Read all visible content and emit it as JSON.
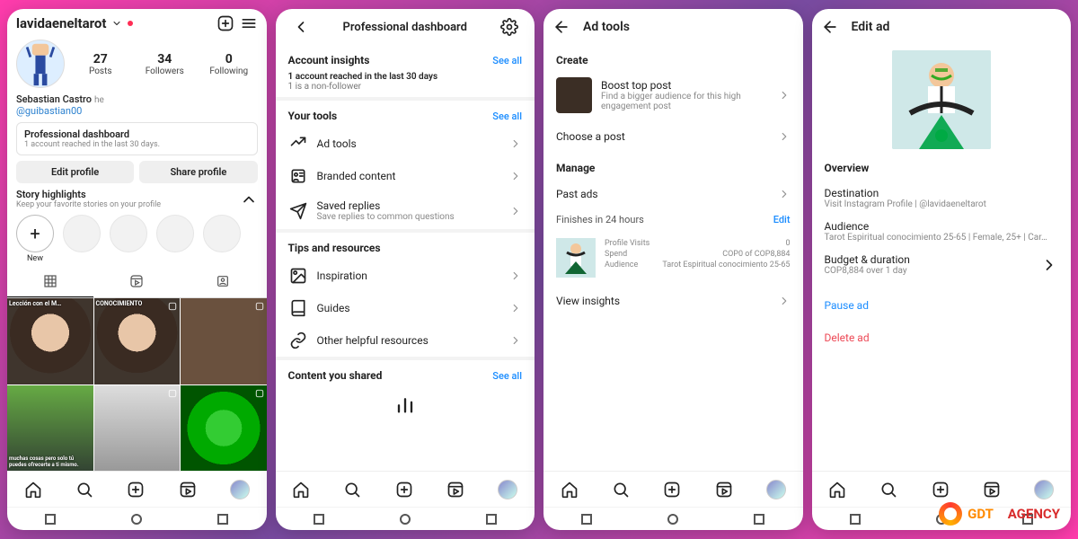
{
  "panel1": {
    "username": "lavidaeneltarot",
    "stats": {
      "posts": {
        "n": "27",
        "l": "Posts"
      },
      "followers": {
        "n": "34",
        "l": "Followers"
      },
      "following": {
        "n": "0",
        "l": "Following"
      }
    },
    "display_name": "Sebastian Castro",
    "pronoun": "he",
    "handle": "@guibastian00",
    "dash_card": {
      "title": "Professional dashboard",
      "sub": "1 account reached in the last 30 days."
    },
    "btn_edit": "Edit profile",
    "btn_share": "Share profile",
    "highlights": {
      "title": "Story highlights",
      "sub": "Keep your favorite stories on your profile",
      "new": "New"
    },
    "grid_caps": [
      "Lección con el M…",
      "CONOCIMIENTO",
      "",
      "muchas cosas pero solo tú puedes ofrecerte a ti mismo.",
      "",
      ""
    ]
  },
  "panel2": {
    "title": "Professional dashboard",
    "insights": {
      "h": "Account insights",
      "see": "See all",
      "l1": "1 account reached in the last 30 days",
      "l2": "1 is a non-follower"
    },
    "tools": {
      "h": "Your tools",
      "see": "See all",
      "items": [
        {
          "t": "Ad tools"
        },
        {
          "t": "Branded content"
        },
        {
          "t": "Saved replies",
          "s": "Save replies to common questions"
        }
      ]
    },
    "tips": {
      "h": "Tips and resources",
      "items": [
        {
          "t": "Inspiration"
        },
        {
          "t": "Guides"
        },
        {
          "t": "Other helpful resources"
        }
      ]
    },
    "shared": {
      "h": "Content you shared",
      "see": "See all"
    }
  },
  "panel3": {
    "title": "Ad tools",
    "create": "Create",
    "boost": {
      "t": "Boost top post",
      "s": "Find a bigger audience for this high engagement post"
    },
    "choose": "Choose a post",
    "manage": "Manage",
    "past": "Past ads",
    "running": {
      "h": "Finishes in 24 hours",
      "edit": "Edit",
      "rows": [
        {
          "k": "Profile Visits",
          "v": "0"
        },
        {
          "k": "Spend",
          "v": "COP0 of COP8,884"
        },
        {
          "k": "Audience",
          "v": "Tarot Espiritual conocimiento 25-65"
        }
      ]
    },
    "view": "View insights"
  },
  "panel4": {
    "title": "Edit ad",
    "overview": "Overview",
    "dest": {
      "t": "Destination",
      "s": "Visit Instagram Profile | @lavidaeneltarot"
    },
    "aud": {
      "t": "Audience",
      "s": "Tarot Espiritual conocimiento 25-65 | Female, 25+ | Car…"
    },
    "bud": {
      "t": "Budget & duration",
      "s": "COP8,884 over 1 day"
    },
    "pause": "Pause ad",
    "delete": "Delete ad"
  },
  "watermark": {
    "a": "GDT",
    "b": "AGENCY"
  }
}
